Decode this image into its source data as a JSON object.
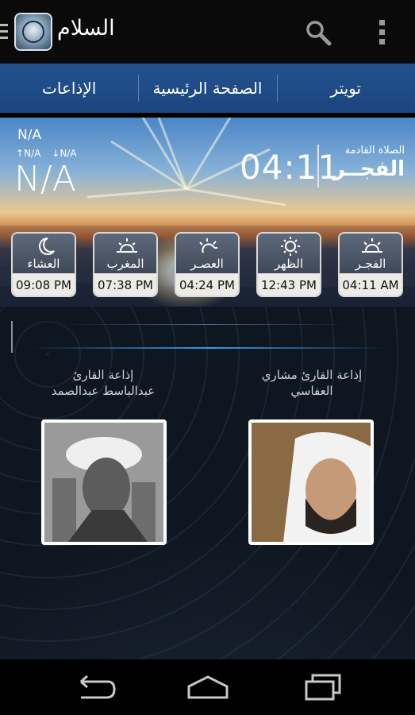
{
  "app": {
    "title": "السلام",
    "icon": "quran-app-icon"
  },
  "actionbar": {
    "search_icon": "search-icon",
    "overflow_icon": "overflow-menu-icon"
  },
  "tabs": [
    {
      "label": "الإذاعات"
    },
    {
      "label": "الصفحة الرئيسية"
    },
    {
      "label": "تويتر"
    }
  ],
  "weather": {
    "current": "N/A",
    "high": "N/A",
    "low": "N/A",
    "temperature": "N/A"
  },
  "next_prayer": {
    "label": "الصلاة القادمة",
    "name": "الفجــر",
    "time": "04:11"
  },
  "prayers": [
    {
      "name": "العشاء",
      "time": "09:08 PM",
      "icon": "crescent-moon-icon"
    },
    {
      "name": "المغرب",
      "time": "07:38 PM",
      "icon": "sunset-icon"
    },
    {
      "name": "العصـر",
      "time": "04:24 PM",
      "icon": "afternoon-sun-icon"
    },
    {
      "name": "الظهر",
      "time": "12:43 PM",
      "icon": "sun-icon"
    },
    {
      "name": "الفجـر",
      "time": "04:11 AM",
      "icon": "sunrise-icon"
    }
  ],
  "stations": [
    {
      "line1": "إذاعة القارئ",
      "line2": "عبدالباسط عبدالصمد"
    },
    {
      "line1": "إذاعة القارئ مشاري",
      "line2": "العفاسي"
    }
  ],
  "navbar": {
    "back_icon": "back-icon",
    "home_icon": "home-icon",
    "recents_icon": "recent-apps-icon"
  }
}
